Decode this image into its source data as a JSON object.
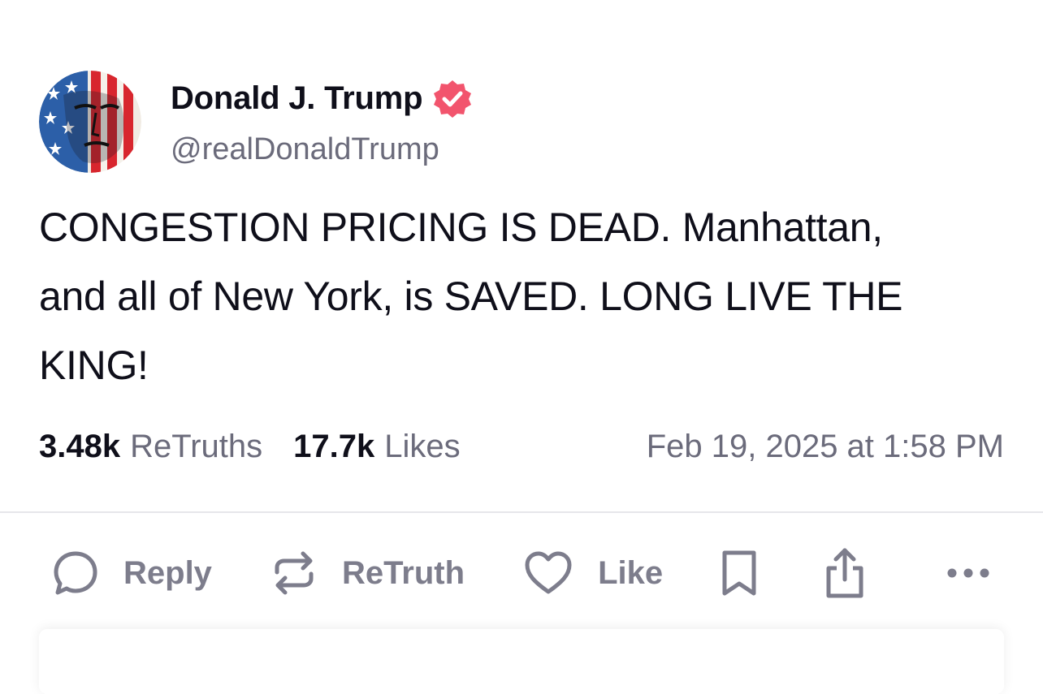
{
  "post": {
    "author": {
      "display_name": "Donald J. Trump",
      "handle": "@realDonaldTrump",
      "verified": true,
      "verified_color": "#f2546d",
      "avatar_icon": "flag-portrait-avatar"
    },
    "text_lines": [
      "CONGESTION PRICING IS DEAD. Manhattan,",
      "and all of New York, is SAVED. LONG LIVE THE",
      "KING!"
    ],
    "stats": {
      "retruths_count": "3.48k",
      "retruths_label": "ReTruths",
      "likes_count": "17.7k",
      "likes_label": "Likes"
    },
    "timestamp": "Feb 19, 2025 at 1:58 PM"
  },
  "actions": {
    "reply_label": "Reply",
    "retruth_label": "ReTruth",
    "like_label": "Like",
    "icons": {
      "reply": "reply-icon",
      "retruth": "retruth-icon",
      "like": "heart-icon",
      "bookmark": "bookmark-icon",
      "share": "share-icon",
      "more": "more-icon"
    }
  },
  "colors": {
    "text": "#0f0f1a",
    "muted": "#6b6b7b",
    "action": "#7d7d8c"
  }
}
